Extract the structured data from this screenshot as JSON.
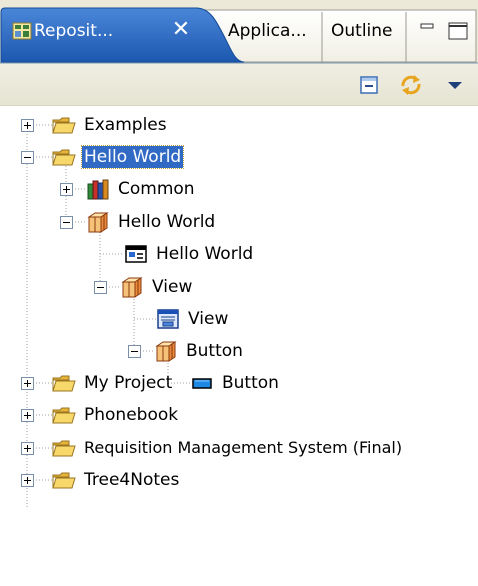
{
  "tabs": [
    {
      "label": "Reposit...",
      "active": true,
      "icon": "repository-icon",
      "close": "✕"
    },
    {
      "label": "Applica...",
      "active": false
    },
    {
      "label": "Outline",
      "active": false
    }
  ],
  "view_controls": {
    "minimize": "minimize-icon",
    "maximize": "maximize-icon"
  },
  "toolbar": {
    "buttons": [
      "collapse-all-icon",
      "sync-icon",
      "view-menu-icon"
    ]
  },
  "colors": {
    "active_tab": "#1e5fb8",
    "selection": "#316ac5",
    "folder": "#f2c84b",
    "toolbar": "#ece9d8"
  },
  "tree": {
    "items": [
      {
        "label": "Examples",
        "icon": "folder-icon",
        "expanded": false
      },
      {
        "label": "Hello World",
        "icon": "folder-icon",
        "expanded": true,
        "selected": true
      },
      {
        "label": "Common",
        "icon": "books-icon",
        "expanded": false
      },
      {
        "label": "Hello World",
        "icon": "package-icon",
        "expanded": true
      },
      {
        "label": "Hello World",
        "icon": "window-icon"
      },
      {
        "label": "View",
        "icon": "package-icon",
        "expanded": true
      },
      {
        "label": "View",
        "icon": "view-form-icon"
      },
      {
        "label": "Button",
        "icon": "package-icon",
        "expanded": true
      },
      {
        "label": "Button",
        "icon": "button-widget-icon"
      },
      {
        "label": "My Project",
        "icon": "folder-icon",
        "expanded": false
      },
      {
        "label": "Phonebook",
        "icon": "folder-icon",
        "expanded": false
      },
      {
        "label": "Requisition Management System (Final)",
        "icon": "folder-icon",
        "expanded": false
      },
      {
        "label": "Tree4Notes",
        "icon": "folder-icon",
        "expanded": false
      }
    ]
  }
}
